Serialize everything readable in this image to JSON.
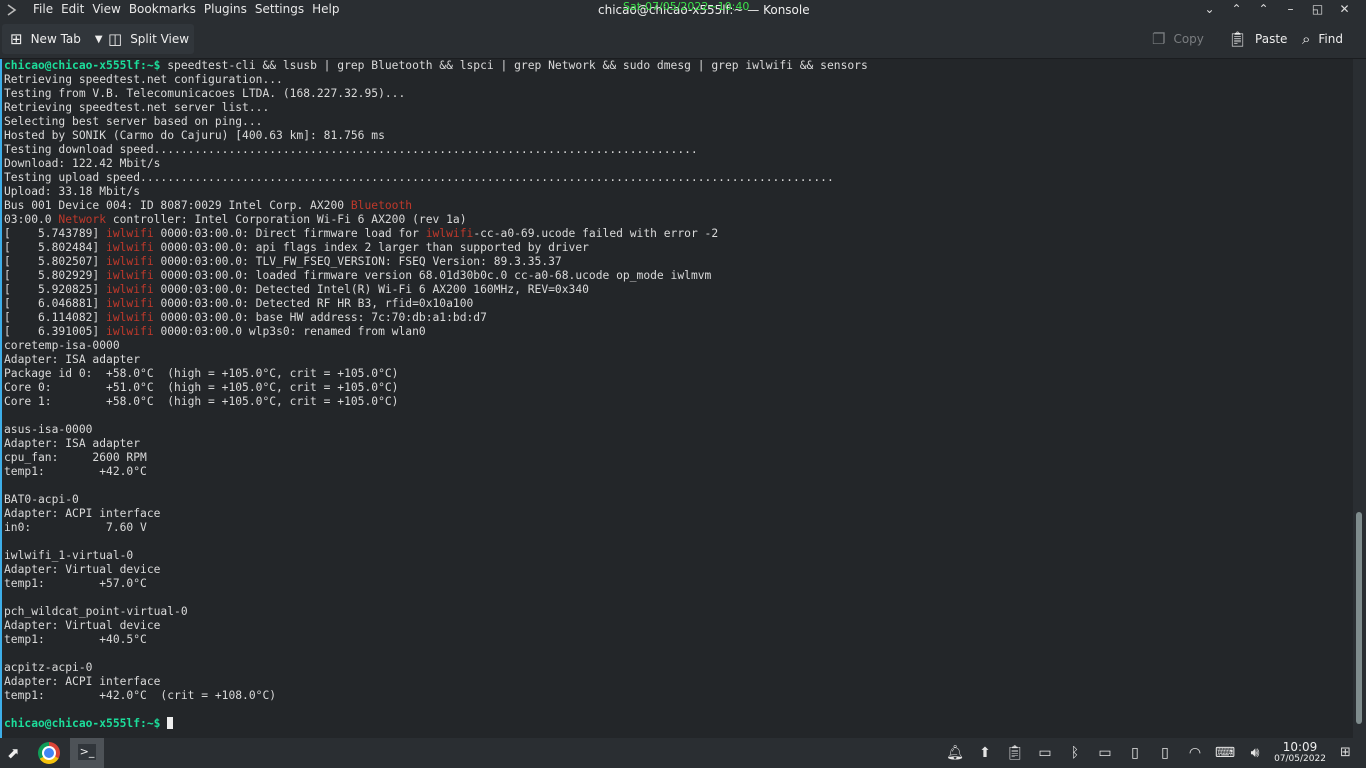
{
  "titlebar": {
    "menus": [
      "File",
      "Edit",
      "View",
      "Bookmarks",
      "Plugins",
      "Settings",
      "Help"
    ],
    "title": "chicao@chicao-x555lf:~ — Konsole",
    "overlay_clock": "Sat-07/05/2022~10:40",
    "buttons": [
      "⌄",
      "⌃",
      "⌃",
      "–",
      "◱",
      "✕"
    ]
  },
  "toolbar": {
    "new_tab": "New Tab",
    "split_view": "Split View",
    "copy": "Copy",
    "paste": "Paste",
    "find": "Find"
  },
  "terminal": {
    "prompt": "chicao@chicao-x555lf:~$",
    "command": " speedtest-cli && lsusb | grep Bluetooth && lspci | grep Network && sudo dmesg | grep iwlwifi && sensors",
    "output": [
      "Retrieving speedtest.net configuration...",
      "Testing from V.B. Telecomunicacoes LTDA. (168.227.32.95)...",
      "Retrieving speedtest.net server list...",
      "Selecting best server based on ping...",
      "Hosted by SONIK (Carmo do Cajuru) [400.63 km]: 81.756 ms",
      "Testing download speed................................................................................",
      "Download: 122.42 Mbit/s",
      "Testing upload speed......................................................................................................",
      "Upload: 33.18 Mbit/s",
      "Bus 001 Device 004: ID 8087:0029 Intel Corp. AX200 |Bluetooth|",
      "03:00.0 |Network| controller: Intel Corporation Wi-Fi 6 AX200 (rev 1a)",
      "[    5.743789] |iwlwifi| 0000:03:00.0: Direct firmware load for |iwlwifi|-cc-a0-69.ucode failed with error -2",
      "[    5.802484] |iwlwifi| 0000:03:00.0: api flags index 2 larger than supported by driver",
      "[    5.802507] |iwlwifi| 0000:03:00.0: TLV_FW_FSEQ_VERSION: FSEQ Version: 89.3.35.37",
      "[    5.802929] |iwlwifi| 0000:03:00.0: loaded firmware version 68.01d30b0c.0 cc-a0-68.ucode op_mode iwlmvm",
      "[    5.920825] |iwlwifi| 0000:03:00.0: Detected Intel(R) Wi-Fi 6 AX200 160MHz, REV=0x340",
      "[    6.046881] |iwlwifi| 0000:03:00.0: Detected RF HR B3, rfid=0x10a100",
      "[    6.114082] |iwlwifi| 0000:03:00.0: base HW address: 7c:70:db:a1:bd:d7",
      "[    6.391005] |iwlwifi| 0000:03:00.0 wlp3s0: renamed from wlan0",
      "coretemp-isa-0000",
      "Adapter: ISA adapter",
      "Package id 0:  +58.0°C  (high = +105.0°C, crit = +105.0°C)",
      "Core 0:        +51.0°C  (high = +105.0°C, crit = +105.0°C)",
      "Core 1:        +58.0°C  (high = +105.0°C, crit = +105.0°C)",
      "",
      "asus-isa-0000",
      "Adapter: ISA adapter",
      "cpu_fan:     2600 RPM",
      "temp1:        +42.0°C",
      "",
      "BAT0-acpi-0",
      "Adapter: ACPI interface",
      "in0:           7.60 V",
      "",
      "iwlwifi_1-virtual-0",
      "Adapter: Virtual device",
      "temp1:        +57.0°C",
      "",
      "pch_wildcat_point-virtual-0",
      "Adapter: Virtual device",
      "temp1:        +40.5°C",
      "",
      "acpitz-acpi-0",
      "Adapter: ACPI interface",
      "temp1:        +42.0°C  (crit = +108.0°C)",
      ""
    ],
    "final_prompt": "chicao@chicao-x555lf:~$"
  },
  "taskbar": {
    "launcher_icon": "kde-launcher-icon",
    "tray_icons": [
      "bell-icon",
      "update-icon",
      "clipboard-icon",
      "battery-icon",
      "bluetooth-icon",
      "display-icon",
      "usb-icon",
      "phone-icon",
      "wifi-icon",
      "keyboard-icon",
      "volume-icon"
    ],
    "time": "10:09",
    "date": "07/05/2022"
  },
  "colors": {
    "background": "#232629",
    "prompt": "#1cdc9a",
    "highlight": "#c0392b",
    "accent": "#3daee9"
  }
}
